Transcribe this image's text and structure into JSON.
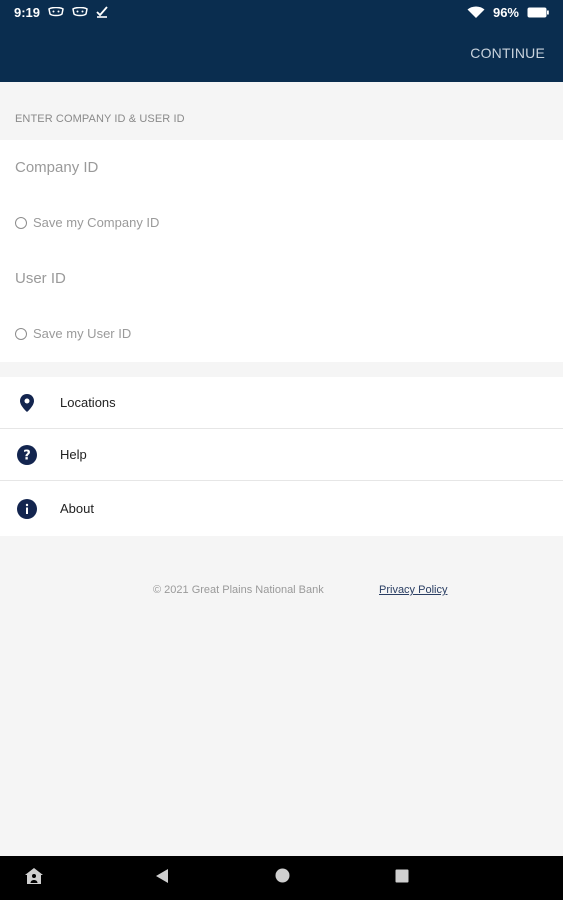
{
  "status_bar": {
    "time": "9:19",
    "battery": "96%"
  },
  "app_bar": {
    "continue_label": "CONTINUE"
  },
  "login": {
    "section_header": "ENTER COMPANY ID & USER ID",
    "company_id_placeholder": "Company ID",
    "save_company_label": "Save my Company ID",
    "user_id_placeholder": "User ID",
    "save_user_label": "Save my User ID"
  },
  "menu": {
    "items": [
      {
        "label": "Locations",
        "icon": "location-pin-icon"
      },
      {
        "label": "Help",
        "icon": "help-icon"
      },
      {
        "label": "About",
        "icon": "info-icon"
      }
    ]
  },
  "footer": {
    "copyright": "© 2021 Great Plains National Bank",
    "privacy_label": "Privacy Policy"
  },
  "colors": {
    "primary": "#0a2d4f",
    "icon": "#13254f",
    "background": "#f5f5f5"
  }
}
